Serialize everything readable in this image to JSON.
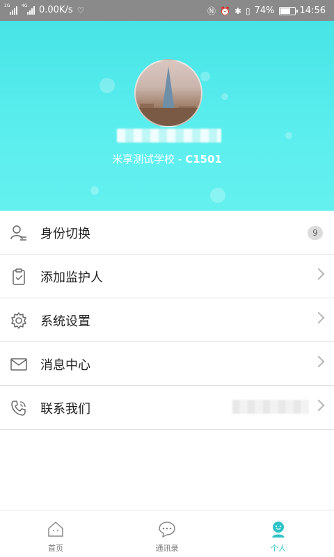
{
  "status_bar": {
    "signal1_label": "2G",
    "signal2_label": "4G",
    "net_speed": "0.00K/s",
    "battery_pct": "74%",
    "battery_level": 0.74,
    "time": "14:56"
  },
  "profile": {
    "school_name": "米享测试学校 - ",
    "class_code": "C1501"
  },
  "menu": {
    "items": [
      {
        "label": "身份切换",
        "badge": "9",
        "icon": "user-switch-icon"
      },
      {
        "label": "添加监护人",
        "icon": "clipboard-check-icon"
      },
      {
        "label": "系统设置",
        "icon": "gear-icon"
      },
      {
        "label": "消息中心",
        "icon": "mail-icon"
      },
      {
        "label": "联系我们",
        "icon": "phone-icon"
      }
    ]
  },
  "bottom_nav": {
    "tabs": [
      {
        "label": "首页",
        "icon": "home-icon"
      },
      {
        "label": "通讯录",
        "icon": "chat-bubble-icon"
      },
      {
        "label": "个人",
        "icon": "person-icon"
      }
    ],
    "active_color": "#2ec4c7"
  },
  "colors": {
    "header": "#52eaea",
    "accent": "#2ec4c7"
  }
}
